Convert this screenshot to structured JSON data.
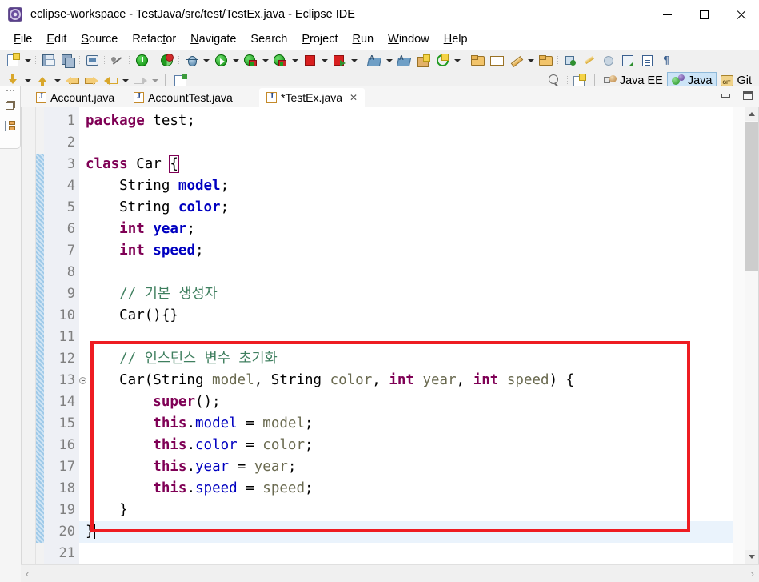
{
  "window": {
    "title": "eclipse-workspace - TestJava/src/test/TestEx.java - Eclipse IDE",
    "app_icon": "eclipse-icon",
    "controls": {
      "minimize": "minimize-icon",
      "maximize": "maximize-icon",
      "close": "close-icon"
    }
  },
  "menubar": {
    "items": [
      {
        "label": "File",
        "mnemonic": "F"
      },
      {
        "label": "Edit",
        "mnemonic": "E"
      },
      {
        "label": "Source",
        "mnemonic": "S"
      },
      {
        "label": "Refactor",
        "mnemonic": "t"
      },
      {
        "label": "Navigate",
        "mnemonic": "N"
      },
      {
        "label": "Search",
        "mnemonic": ""
      },
      {
        "label": "Project",
        "mnemonic": "P"
      },
      {
        "label": "Run",
        "mnemonic": "R"
      },
      {
        "label": "Window",
        "mnemonic": "W"
      },
      {
        "label": "Help",
        "mnemonic": "H"
      }
    ]
  },
  "toolbar": {
    "row1": [
      "new-wizard-icon",
      "dropdown",
      "sep",
      "save-icon",
      "save-all-icon",
      "sep",
      "print-icon",
      "sep",
      "no-reference-icon",
      "sep",
      "terminate-icon",
      "sep",
      "debug-certificate-icon",
      "sep",
      "external-tools-icon",
      "dropdown",
      "run-icon",
      "dropdown",
      "run-as-icon",
      "dropdown",
      "coverage-icon",
      "dropdown",
      "stop-icon",
      "dropdown",
      "stop-run-icon",
      "dropdown",
      "sep",
      "new-java-project-icon",
      "dropdown",
      "new-java-class-icon",
      "new-package-icon",
      "new-annotation-icon",
      "dropdown",
      "sep",
      "open-type-icon",
      "open-resource-icon",
      "quick-fix-icon",
      "dropdown",
      "open-task-icon",
      "sep",
      "pin-editor-icon",
      "brush-icon",
      "skip-icon",
      "export-icon",
      "outline-list-icon",
      "pilcrow-icon"
    ],
    "row2": [
      "step-into-icon",
      "dropdown",
      "step-return-icon",
      "dropdown",
      "prev-annotation-icon",
      "next-annotation-icon",
      "back-icon",
      "dropdown",
      "forward-icon",
      "dropdown",
      "vsep",
      "new-editor-icon"
    ],
    "search_icon": "search-icon",
    "open-perspective-icon": "open-perspective-icon"
  },
  "perspectives": {
    "items": [
      {
        "label": "Java EE",
        "icon": "java-ee-perspective-icon",
        "active": false
      },
      {
        "label": "Java",
        "icon": "java-perspective-icon",
        "active": true
      },
      {
        "label": "Git",
        "icon": "git-perspective-icon",
        "active": false
      }
    ]
  },
  "left_rail": {
    "items": [
      {
        "name": "restore-view-icon"
      },
      {
        "name": "outline-view-icon"
      }
    ]
  },
  "editor": {
    "tabs": [
      {
        "label": "Account.java",
        "active": false,
        "dirty": false,
        "closable": false
      },
      {
        "label": "AccountTest.java",
        "active": false,
        "dirty": false,
        "closable": false
      },
      {
        "label": "*TestEx.java",
        "active": true,
        "dirty": true,
        "closable": true
      }
    ],
    "tab_close_glyph": "✕",
    "panel_buttons": {
      "minimize": "minimize-panel-icon",
      "maximize": "maximize-panel-icon"
    },
    "current_line": 20,
    "total_lines": 21,
    "lines": [
      {
        "n": 1,
        "fold": false,
        "tokens": [
          {
            "t": "package",
            "c": "k"
          },
          {
            "t": " test;",
            "c": "pl"
          }
        ]
      },
      {
        "n": 2,
        "fold": false,
        "tokens": []
      },
      {
        "n": 3,
        "fold": false,
        "tokens": [
          {
            "t": "class",
            "c": "k"
          },
          {
            "t": " Car ",
            "c": "pl"
          },
          {
            "t": "{",
            "c": "brk"
          }
        ]
      },
      {
        "n": 4,
        "fold": false,
        "tokens": [
          {
            "t": "    String ",
            "c": "pl"
          },
          {
            "t": "model",
            "c": "fld"
          },
          {
            "t": ";",
            "c": "pl"
          }
        ]
      },
      {
        "n": 5,
        "fold": false,
        "tokens": [
          {
            "t": "    String ",
            "c": "pl"
          },
          {
            "t": "color",
            "c": "fld"
          },
          {
            "t": ";",
            "c": "pl"
          }
        ]
      },
      {
        "n": 6,
        "fold": false,
        "tokens": [
          {
            "t": "    ",
            "c": "pl"
          },
          {
            "t": "int",
            "c": "k"
          },
          {
            "t": " ",
            "c": "pl"
          },
          {
            "t": "year",
            "c": "fld"
          },
          {
            "t": ";",
            "c": "pl"
          }
        ]
      },
      {
        "n": 7,
        "fold": false,
        "tokens": [
          {
            "t": "    ",
            "c": "pl"
          },
          {
            "t": "int",
            "c": "k"
          },
          {
            "t": " ",
            "c": "pl"
          },
          {
            "t": "speed",
            "c": "fld"
          },
          {
            "t": ";",
            "c": "pl"
          }
        ]
      },
      {
        "n": 8,
        "fold": false,
        "tokens": []
      },
      {
        "n": 9,
        "fold": false,
        "tokens": [
          {
            "t": "    // 기본 생성자",
            "c": "cmt"
          }
        ]
      },
      {
        "n": 10,
        "fold": false,
        "tokens": [
          {
            "t": "    Car(){}",
            "c": "pl"
          }
        ]
      },
      {
        "n": 11,
        "fold": false,
        "tokens": []
      },
      {
        "n": 12,
        "fold": false,
        "tokens": [
          {
            "t": "    // 인스턴스 변수 초기화",
            "c": "cmt"
          }
        ]
      },
      {
        "n": 13,
        "fold": true,
        "tokens": [
          {
            "t": "    Car(String ",
            "c": "pl"
          },
          {
            "t": "model",
            "c": "par"
          },
          {
            "t": ", String ",
            "c": "pl"
          },
          {
            "t": "color",
            "c": "par"
          },
          {
            "t": ", ",
            "c": "pl"
          },
          {
            "t": "int",
            "c": "k"
          },
          {
            "t": " ",
            "c": "pl"
          },
          {
            "t": "year",
            "c": "par"
          },
          {
            "t": ", ",
            "c": "pl"
          },
          {
            "t": "int",
            "c": "k"
          },
          {
            "t": " ",
            "c": "pl"
          },
          {
            "t": "speed",
            "c": "par"
          },
          {
            "t": ") {",
            "c": "pl"
          }
        ]
      },
      {
        "n": 14,
        "fold": false,
        "tokens": [
          {
            "t": "        ",
            "c": "pl"
          },
          {
            "t": "super",
            "c": "k"
          },
          {
            "t": "();",
            "c": "pl"
          }
        ]
      },
      {
        "n": 15,
        "fold": false,
        "tokens": [
          {
            "t": "        ",
            "c": "pl"
          },
          {
            "t": "this",
            "c": "k"
          },
          {
            "t": ".",
            "c": "pl"
          },
          {
            "t": "model",
            "c": "fldn"
          },
          {
            "t": " = ",
            "c": "pl"
          },
          {
            "t": "model",
            "c": "par"
          },
          {
            "t": ";",
            "c": "pl"
          }
        ]
      },
      {
        "n": 16,
        "fold": false,
        "tokens": [
          {
            "t": "        ",
            "c": "pl"
          },
          {
            "t": "this",
            "c": "k"
          },
          {
            "t": ".",
            "c": "pl"
          },
          {
            "t": "color",
            "c": "fldn"
          },
          {
            "t": " = ",
            "c": "pl"
          },
          {
            "t": "color",
            "c": "par"
          },
          {
            "t": ";",
            "c": "pl"
          }
        ]
      },
      {
        "n": 17,
        "fold": false,
        "tokens": [
          {
            "t": "        ",
            "c": "pl"
          },
          {
            "t": "this",
            "c": "k"
          },
          {
            "t": ".",
            "c": "pl"
          },
          {
            "t": "year",
            "c": "fldn"
          },
          {
            "t": " = ",
            "c": "pl"
          },
          {
            "t": "year",
            "c": "par"
          },
          {
            "t": ";",
            "c": "pl"
          }
        ]
      },
      {
        "n": 18,
        "fold": false,
        "tokens": [
          {
            "t": "        ",
            "c": "pl"
          },
          {
            "t": "this",
            "c": "k"
          },
          {
            "t": ".",
            "c": "pl"
          },
          {
            "t": "speed",
            "c": "fldn"
          },
          {
            "t": " = ",
            "c": "pl"
          },
          {
            "t": "speed",
            "c": "par"
          },
          {
            "t": ";",
            "c": "pl"
          }
        ]
      },
      {
        "n": 19,
        "fold": false,
        "tokens": [
          {
            "t": "    }",
            "c": "pl"
          }
        ]
      },
      {
        "n": 20,
        "fold": false,
        "caret": true,
        "tokens": [
          {
            "t": "}",
            "c": "pl"
          }
        ]
      },
      {
        "n": 21,
        "fold": false,
        "tokens": []
      }
    ],
    "annotation_box": {
      "color": "#ee1c22",
      "covers_lines": "12-20"
    },
    "scroll": {
      "up_glyph": "chevron-up-icon",
      "down_glyph": "chevron-down-icon"
    },
    "hscroll": {
      "left_glyph": "‹",
      "right_glyph": "›"
    }
  },
  "colors": {
    "keyword": "#7f0055",
    "field": "#0000c0",
    "parameter": "#6a6a50",
    "comment": "#3f7f5f",
    "plain": "#000000",
    "current_line_bg": "#eaf3fc",
    "annotation_red": "#ee1c22",
    "perspective_active_bg": "#cce4f7"
  }
}
